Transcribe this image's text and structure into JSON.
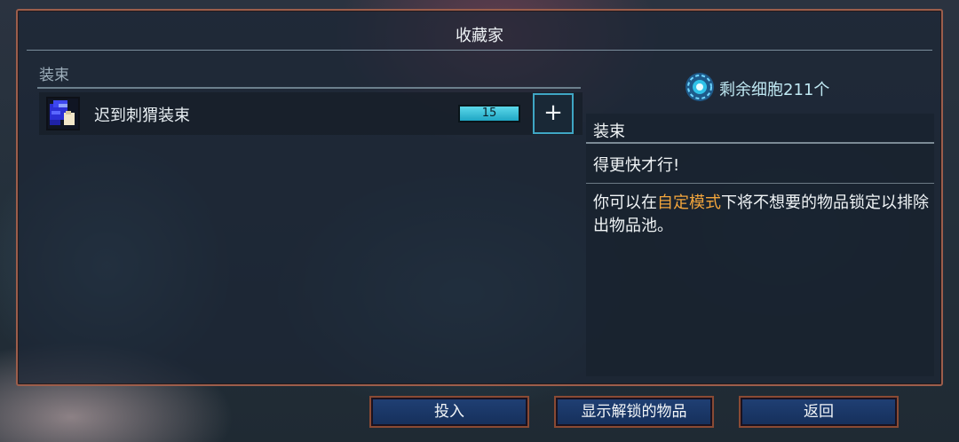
{
  "window": {
    "title": "收藏家"
  },
  "list": {
    "category": "装束",
    "items": [
      {
        "name": "迟到刺猬装束",
        "level": "15",
        "icon": "outfit-icon"
      }
    ],
    "add_label": "+"
  },
  "cells": {
    "label": "剩余细胞211个",
    "icon": "cell-icon"
  },
  "detail": {
    "category": "装束",
    "subtitle": "得更快才行!",
    "desc_pre": "你可以在",
    "desc_highlight": "自定模式",
    "desc_post": "下将不想要的物品锁定以排除出物品池。"
  },
  "buttons": {
    "invest": "投入",
    "show_unlocked": "显示解锁的物品",
    "back": "返回"
  },
  "colors": {
    "frame_border": "#9c5e4c",
    "highlight": "#f2a53c",
    "button_fill": "#1f3f73",
    "accent_cyan": "#3fa6c4"
  }
}
